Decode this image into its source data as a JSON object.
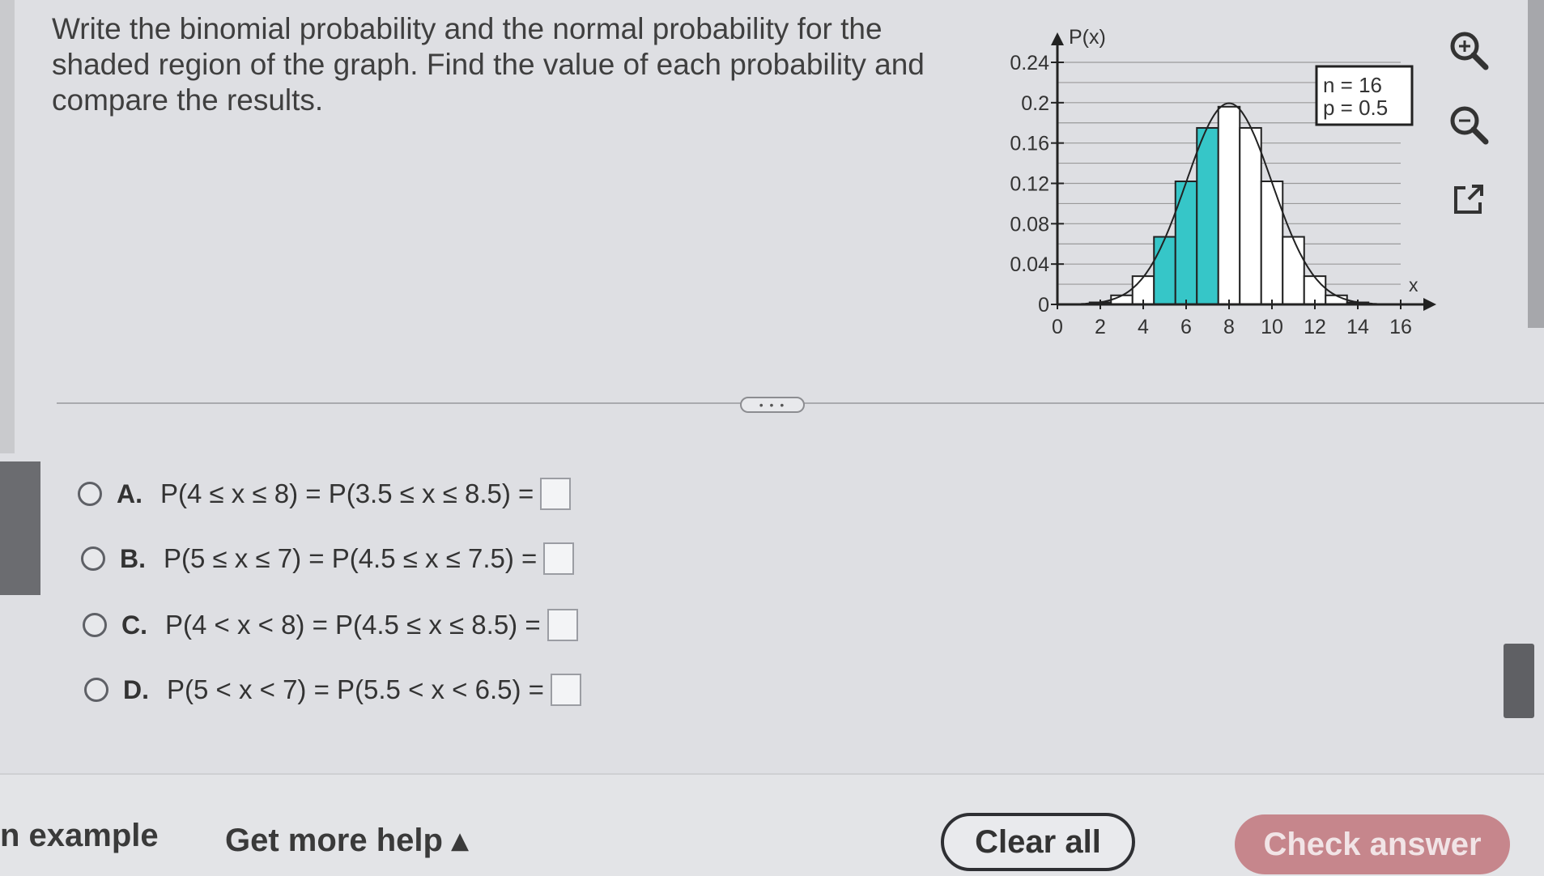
{
  "question": {
    "text": "Write the binomial probability and the normal probability for the shaded region of the graph. Find the value of each probability and compare the results."
  },
  "chart_data": {
    "type": "bar",
    "y_axis_label": "P(x)",
    "x_axis_label": "x",
    "y_ticks": [
      "0.24",
      "0.2",
      "0.16",
      "0.12",
      "0.08",
      "0.04",
      "0"
    ],
    "x_ticks": [
      "0",
      "2",
      "4",
      "6",
      "8",
      "10",
      "12",
      "14",
      "16"
    ],
    "ylim": [
      0,
      0.24
    ],
    "xlim": [
      0,
      16
    ],
    "legend_lines": [
      "n = 16",
      "p = 0.5"
    ],
    "x": [
      2,
      3,
      4,
      5,
      6,
      7,
      8,
      9,
      10,
      11,
      12,
      13,
      14
    ],
    "values": [
      0.002,
      0.009,
      0.028,
      0.067,
      0.122,
      0.175,
      0.196,
      0.175,
      0.122,
      0.067,
      0.028,
      0.009,
      0.002
    ],
    "shaded_x": [
      5,
      6,
      7
    ],
    "shade_color": "#36c6c8",
    "normal_curve": {
      "mean": 8,
      "sd": 2
    },
    "grid": true
  },
  "options": [
    {
      "letter": "A.",
      "expr": "P(4 ≤ x ≤ 8) = P(3.5 ≤ x ≤ 8.5) ="
    },
    {
      "letter": "B.",
      "expr": "P(5 ≤ x ≤ 7) = P(4.5 ≤ x ≤ 7.5) ="
    },
    {
      "letter": "C.",
      "expr": "P(4 < x < 8) = P(4.5 ≤ x ≤ 8.5) ="
    },
    {
      "letter": "D.",
      "expr": "P(5 < x < 7) = P(5.5 < x < 6.5) ="
    }
  ],
  "expander": {
    "label": "• • •"
  },
  "footer": {
    "example_label": "n example",
    "help_label": "Get more help ▴",
    "clear_label": "Clear all",
    "check_label": "Check answer"
  },
  "icons": [
    "zoom-in-icon",
    "zoom-out-icon",
    "popout-icon"
  ]
}
